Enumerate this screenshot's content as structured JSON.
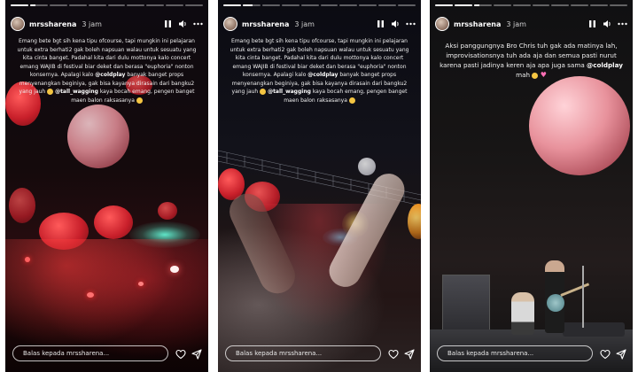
{
  "stories": [
    {
      "username": "mrssharena",
      "time": "3 jam",
      "progress": [
        1,
        0.3,
        0,
        0,
        0,
        0,
        0,
        0,
        0,
        0
      ],
      "caption_segments": [
        {
          "t": "Emang bete bgt sih kena tipu ofcourse, tapi mungkin ini pelajaran untuk extra berhati2 gak boleh napsuan walau untuk sesuatu yang kita cinta banget. Padahal kita dari dulu mottonya kalo concert emang WAJIB di festival biar deket dan berasa \"euphoria\" nonton konsernya. Apalagi kalo "
        },
        {
          "t": "@coldplay",
          "mention": true
        },
        {
          "t": " banyak banget props menyenangkan beginiya, gak bisa kayanya dirasain dari bangku2 yang jauh "
        },
        {
          "emoji": "smiling-face"
        },
        {
          "t": " "
        },
        {
          "t": "@tall_wagging",
          "mention": true
        },
        {
          "t": " kaya bocah emang, pengen banget maen balon raksasanya "
        },
        {
          "emoji": "smiling-face"
        }
      ],
      "reply_placeholder": "Balas kepada mrssharena..."
    },
    {
      "username": "mrssharena",
      "time": "3 jam",
      "progress": [
        1,
        0.55,
        0,
        0,
        0,
        0,
        0,
        0,
        0,
        0
      ],
      "caption_segments": [
        {
          "t": "Emang bete bgt sih kena tipu ofcourse, tapi mungkin ini pelajaran untuk extra berhati2 gak boleh napsuan walau untuk sesuatu yang kita cinta banget. Padahal kita dari dulu mottonya kalo concert emang WAJIB di festival biar deket dan berasa \"euphoria\" nonton konsernya. Apalagi kalo "
        },
        {
          "t": "@coldplay",
          "mention": true
        },
        {
          "t": " banyak banget props menyenangkan beginiya, gak bisa kayanya dirasain dari bangku2 yang jauh "
        },
        {
          "emoji": "smiling-face"
        },
        {
          "t": " "
        },
        {
          "t": "@tall_wagging",
          "mention": true
        },
        {
          "t": " kaya bocah emang, pengen banget maen balon raksasanya "
        },
        {
          "emoji": "smiling-face"
        }
      ],
      "reply_placeholder": "Balas kepada mrssharena..."
    },
    {
      "username": "mrssharena",
      "time": "3 jam",
      "progress": [
        1,
        1,
        0.3,
        0,
        0,
        0,
        0,
        0,
        0,
        0
      ],
      "caption_segments": [
        {
          "t": "Aksi panggungnya Bro Chris tuh gak ada matinya lah, improvisationsnya tuh ada aja dan semua pasti nurut karena pasti jadinya keren aja apa juga sama "
        },
        {
          "t": "@coldplay",
          "mention": true
        },
        {
          "t": " mah "
        },
        {
          "emoji": "smiling-face"
        },
        {
          "t": " "
        },
        {
          "emoji": "pink-heart"
        }
      ],
      "reply_placeholder": "Balas kepada mrssharena..."
    }
  ],
  "icons": {
    "pause": "pause-icon",
    "sound": "speaker-icon",
    "more": "more-icon",
    "like": "heart-icon",
    "share": "send-icon"
  },
  "colors": {
    "text": "#ffffff",
    "mention": "#ffffff",
    "emoji": "#f4c542",
    "heart": "#ff6fb5"
  }
}
